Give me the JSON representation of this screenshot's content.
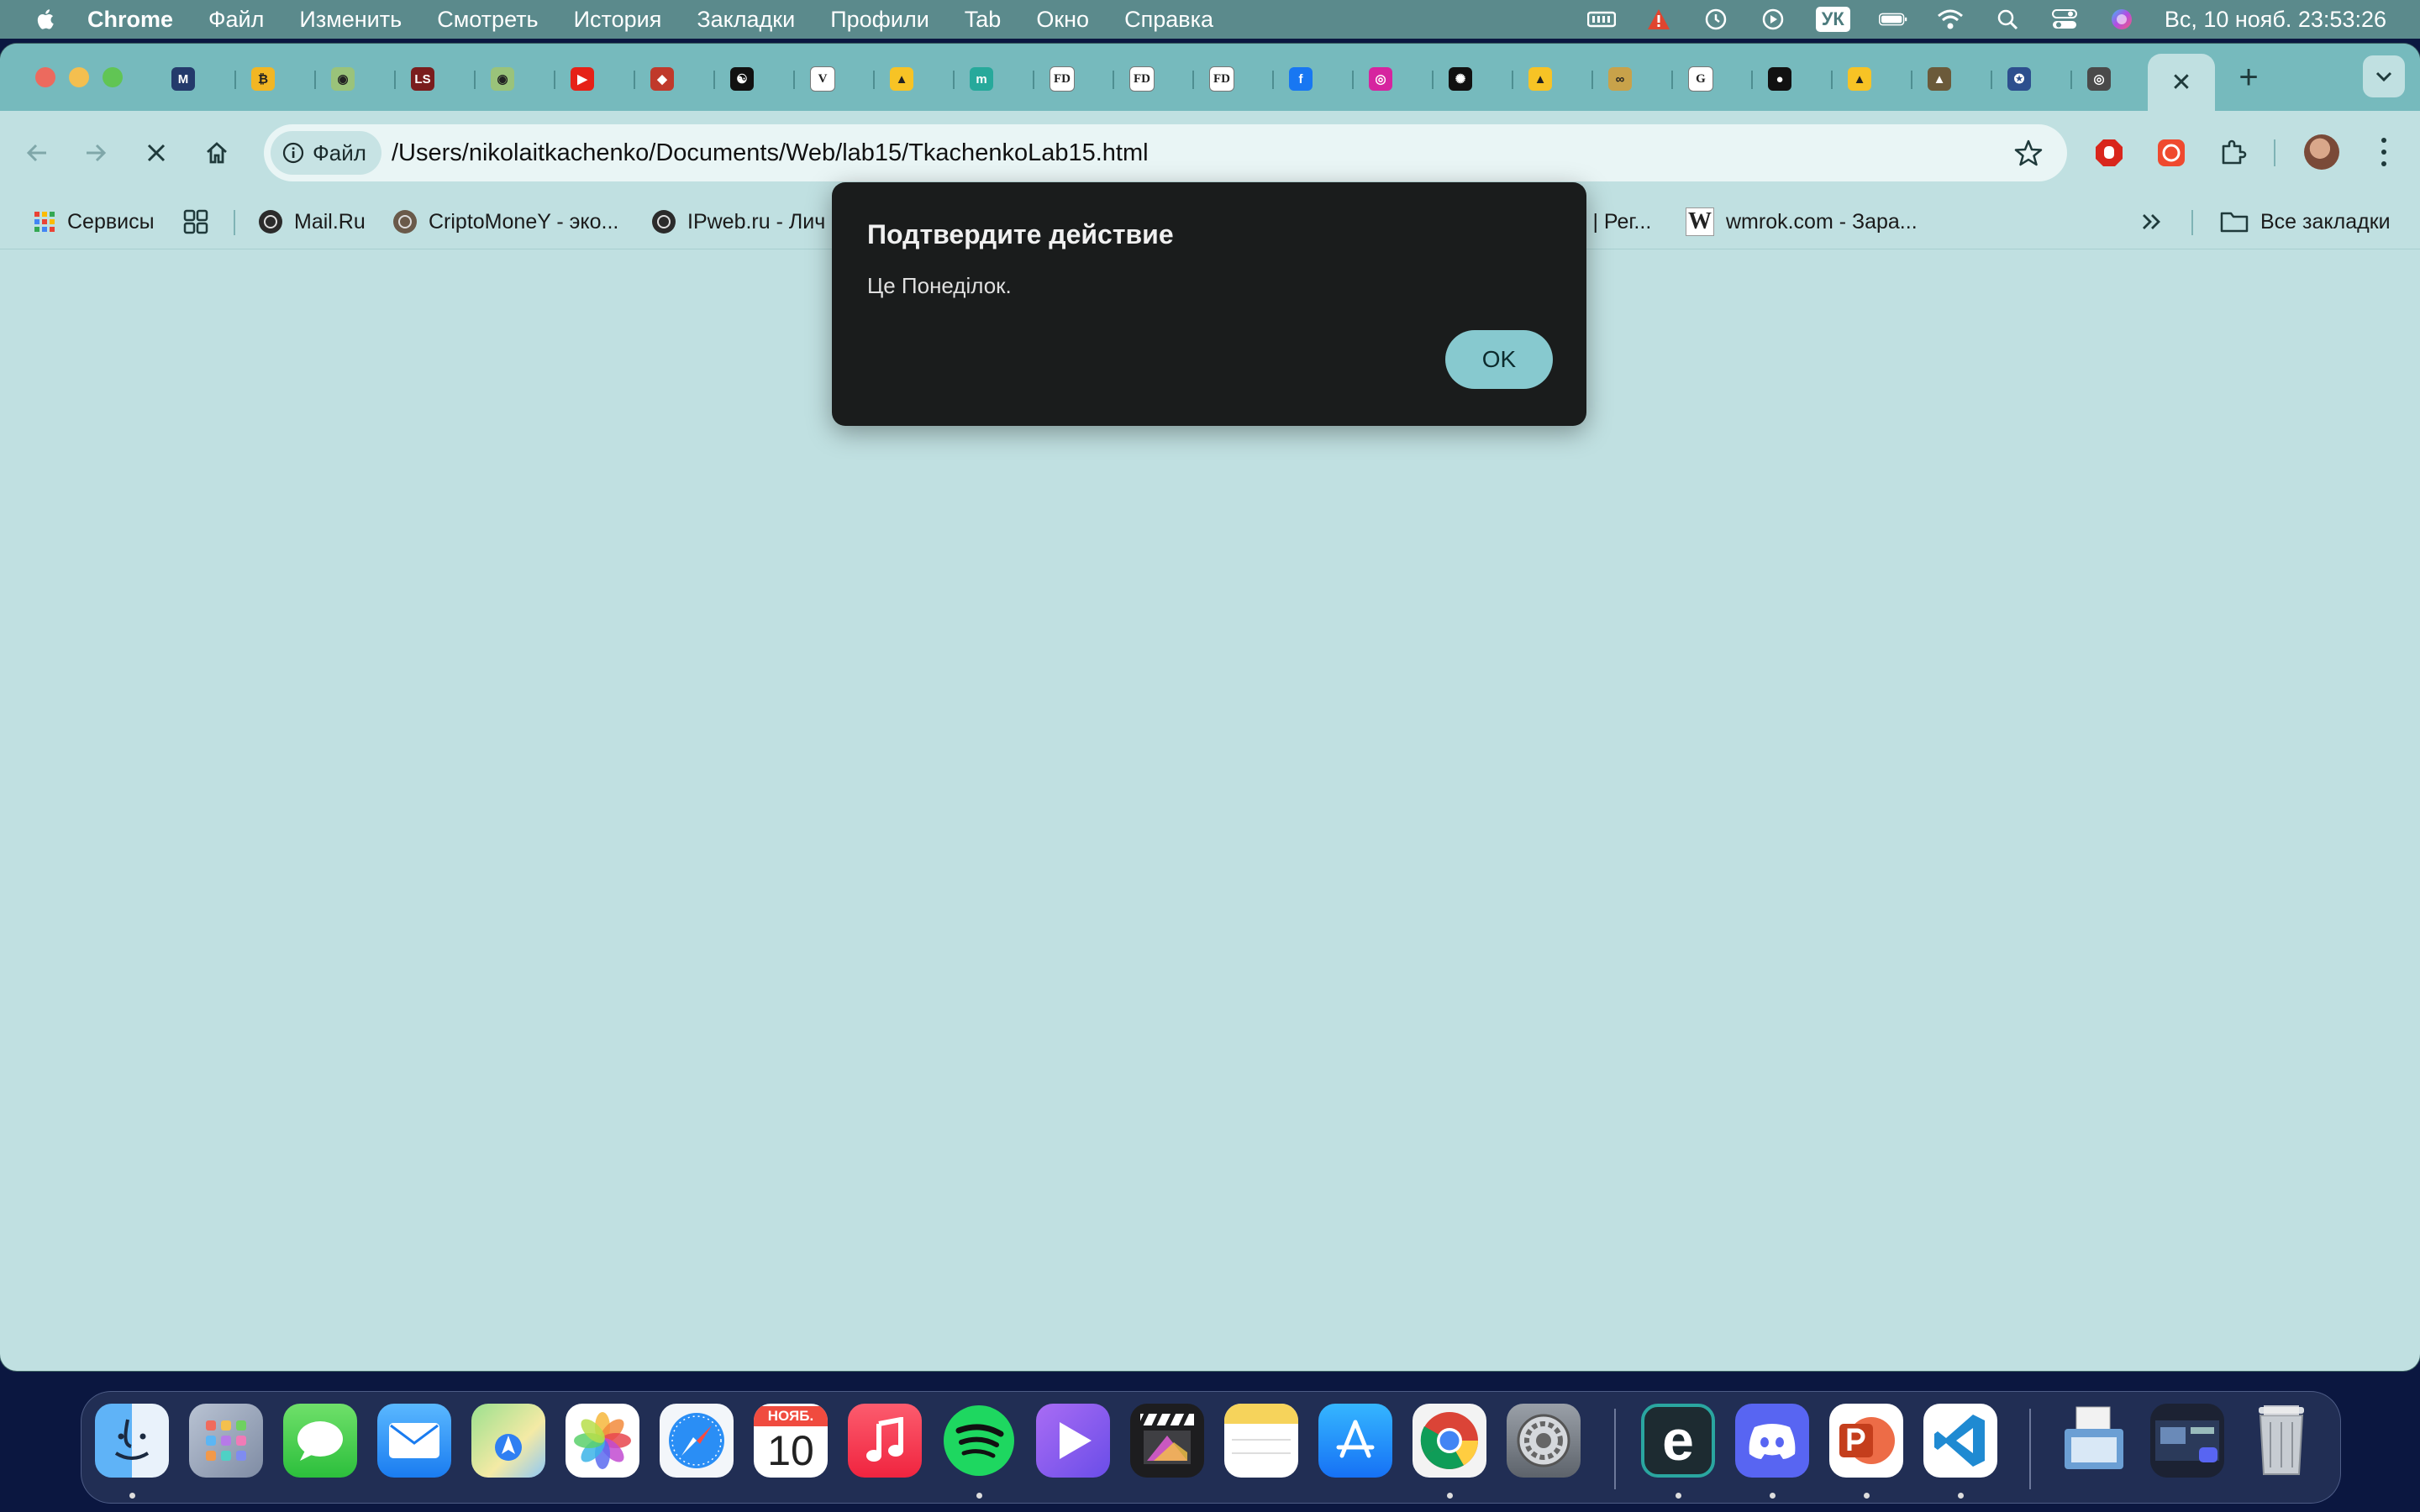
{
  "menubar": {
    "app_name": "Chrome",
    "items": [
      "Файл",
      "Изменить",
      "Смотреть",
      "История",
      "Закладки",
      "Профили",
      "Tab",
      "Окно",
      "Справка"
    ],
    "keyboard_layout": "УК",
    "clock": "Вс, 10 нояб.  23:53:26"
  },
  "browser": {
    "address": {
      "chip_label": "Файл",
      "url": "/Users/nikolaitkachenko/Documents/Web/lab15/TkachenkoLab15.html"
    },
    "tabs": [
      {
        "icon": "metamask-icon",
        "color": "#243a6b",
        "glyph": "M"
      },
      {
        "icon": "coin-icon",
        "color": "#f2b623",
        "glyph": "₿"
      },
      {
        "icon": "panda-icon",
        "color": "#9ac37a",
        "glyph": "◉"
      },
      {
        "icon": "red-square-icon",
        "color": "#7a1d1d",
        "glyph": "LS"
      },
      {
        "icon": "panda-icon",
        "color": "#9ac37a",
        "glyph": "◉"
      },
      {
        "icon": "youtube-icon",
        "color": "#e62117",
        "glyph": "▶"
      },
      {
        "icon": "fox-icon",
        "color": "#c0392b",
        "glyph": "◆"
      },
      {
        "icon": "yin-yang-icon",
        "color": "#111111",
        "glyph": "☯"
      },
      {
        "icon": "v-icon",
        "color": "#ffffff",
        "glyph": "V"
      },
      {
        "icon": "google-drive-icon",
        "color": "#f7c325",
        "glyph": "▲"
      },
      {
        "icon": "m-icon",
        "color": "#27a99b",
        "glyph": "m"
      },
      {
        "icon": "fd-icon",
        "color": "#ffffff",
        "glyph": "FD"
      },
      {
        "icon": "fd-icon",
        "color": "#ffffff",
        "glyph": "FD"
      },
      {
        "icon": "fd-icon",
        "color": "#ffffff",
        "glyph": "FD"
      },
      {
        "icon": "facebook-icon",
        "color": "#1877f2",
        "glyph": "f"
      },
      {
        "icon": "instagram-icon",
        "color": "#d6249f",
        "glyph": "◎"
      },
      {
        "icon": "openai-icon",
        "color": "#111111",
        "glyph": "✺"
      },
      {
        "icon": "google-drive-icon",
        "color": "#f7c325",
        "glyph": "▲"
      },
      {
        "icon": "glasses-icon",
        "color": "#c8a24a",
        "glyph": "∞"
      },
      {
        "icon": "google-icon",
        "color": "#ffffff",
        "glyph": "G"
      },
      {
        "icon": "github-icon",
        "color": "#111111",
        "glyph": "●"
      },
      {
        "icon": "google-drive-icon",
        "color": "#f7c325",
        "glyph": "▲"
      },
      {
        "icon": "graduation-cap-icon",
        "color": "#6b5a3a",
        "glyph": "▲"
      },
      {
        "icon": "emblem-icon",
        "color": "#2d4f8e",
        "glyph": "✪"
      },
      {
        "icon": "chrome-icon",
        "color": "#4a4a4a",
        "glyph": "◎"
      }
    ],
    "bookmarks": [
      {
        "label": "Сервисы",
        "icon": "apps-grid-icon"
      },
      {
        "label": "",
        "icon": "tab-groups-icon"
      },
      {
        "label": "Mail.Ru",
        "icon": "globe-icon"
      },
      {
        "label": "CriptoMoneY - эко...",
        "icon": "coin-icon"
      },
      {
        "label": "IPweb.ru - Лич",
        "icon": "globe-icon"
      },
      {
        "label": "s | Рег...",
        "icon": "none"
      },
      {
        "label": "wmrok.com - Зара...",
        "icon": "w-icon"
      }
    ],
    "all_bookmarks": "Все закладки"
  },
  "dialog": {
    "title": "Подтвердите действие",
    "message": "Це Понеділок.",
    "ok_label": "OK"
  },
  "dock": {
    "calendar_month": "НОЯБ.",
    "calendar_day": "10"
  }
}
